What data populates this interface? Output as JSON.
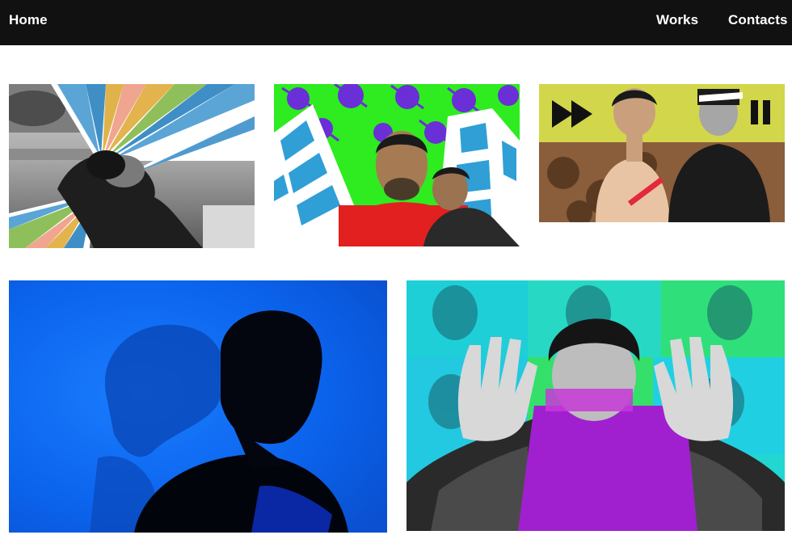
{
  "nav": {
    "home": "Home",
    "works": "Works",
    "contacts": "Contacts"
  },
  "colors": {
    "topbar": "#111111",
    "page_background": "#ffffff",
    "nav_text": "#ffffff"
  },
  "gallery": {
    "items": [
      {
        "icon": "rainbow-rays-portrait-thumbnail"
      },
      {
        "icon": "towers-and-leaves-portrait-thumbnail"
      },
      {
        "icon": "fast-forward-pause-portrait-thumbnail"
      },
      {
        "icon": "blue-silhouette-portrait-thumbnail"
      },
      {
        "icon": "hands-up-purple-portrait-thumbnail"
      }
    ]
  }
}
